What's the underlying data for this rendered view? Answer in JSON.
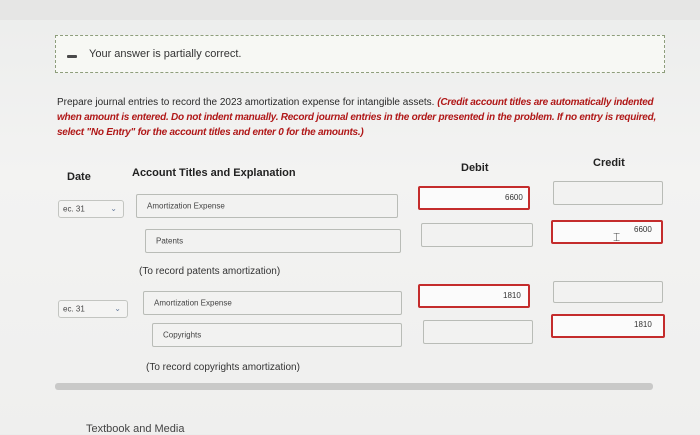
{
  "feedback": {
    "message": "Your answer is partially correct."
  },
  "instructions": {
    "plain": "Prepare journal entries to record the 2023 amortization expense for intangible assets. ",
    "red": "(Credit account titles are automatically indented when amount is entered. Do not indent manually. Record journal entries in the order presented in the problem. If no entry is required, select \"No Entry\" for the account titles and enter 0 for the amounts.)"
  },
  "table": {
    "headers": {
      "date": "Date",
      "account": "Account Titles and Explanation",
      "debit": "Debit",
      "credit": "Credit"
    }
  },
  "entries": [
    {
      "date": "ec. 31",
      "lines": [
        {
          "account": "Amortization Expense",
          "debit": "6600",
          "credit": ""
        },
        {
          "account": "Patents",
          "debit": "",
          "credit": "6600"
        }
      ],
      "memo": "(To record patents amortization)"
    },
    {
      "date": "ec. 31",
      "lines": [
        {
          "account": "Amortization Expense",
          "debit": "1810",
          "credit": ""
        },
        {
          "account": "Copyrights",
          "debit": "",
          "credit": "1810"
        }
      ],
      "memo": "(To record copyrights amortization)"
    }
  ],
  "footer": {
    "label": "Textbook and Media"
  },
  "icons": {
    "feedback": "minus-icon",
    "dropdown": "chevron-down-icon",
    "cursor": "text-cursor-icon"
  }
}
